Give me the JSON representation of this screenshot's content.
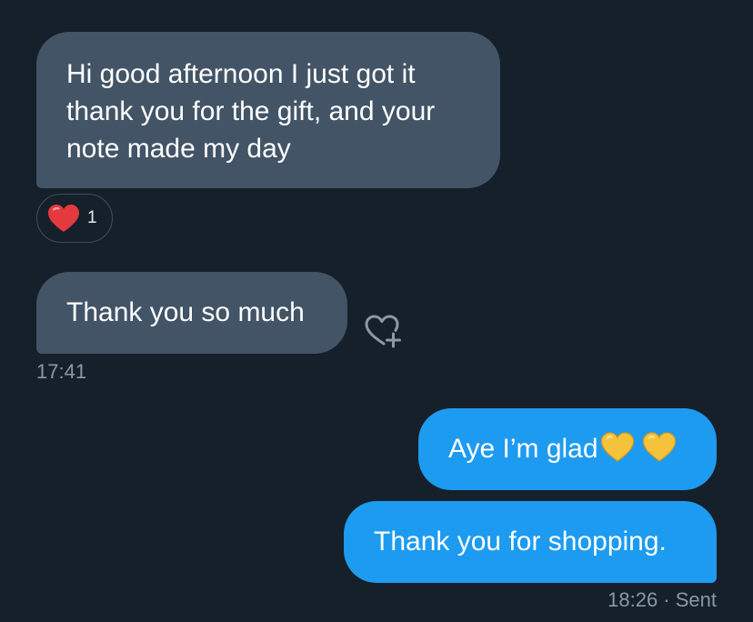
{
  "conversation": {
    "messages": [
      {
        "direction": "received",
        "text": "Hi good afternoon I just got it thank you for the gift, and your note made my day"
      },
      {
        "direction": "received",
        "text": "Thank you so much"
      },
      {
        "direction": "sent",
        "text": "Aye I’m glad"
      },
      {
        "direction": "sent",
        "text": "Thank you for shopping."
      }
    ],
    "reaction": {
      "emoji": "heart-emoji",
      "count": "1"
    },
    "received_time": "17:41",
    "sent_status": "18:26 · Sent"
  },
  "icons": {
    "add_reaction": "heart-plus-icon",
    "emoji_1": "yellow-heart-emoji",
    "emoji_2": "yellow-heart-emoji"
  },
  "colors": {
    "background": "#15202b",
    "received_bubble": "#425466",
    "sent_bubble": "#1d9bf0",
    "timestamp": "#8b98a5"
  }
}
